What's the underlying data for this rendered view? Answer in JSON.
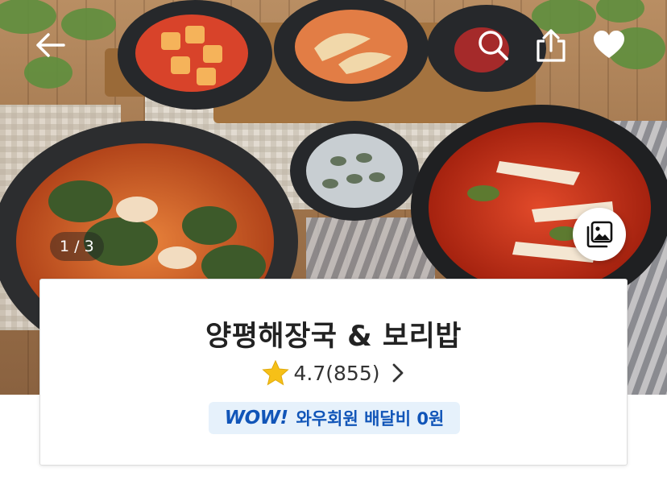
{
  "hero": {
    "image_alt": "food photo",
    "counter": "1 / 3"
  },
  "topbar": {
    "back_icon": "arrow-left-icon",
    "search_icon": "search-icon",
    "share_icon": "share-icon",
    "favorite_icon": "heart-icon"
  },
  "gallery": {
    "icon": "photo-gallery-icon"
  },
  "store": {
    "name": "양평해장국 & 보리밥",
    "rating": "4.7",
    "review_count": "(855)",
    "membership": {
      "logo": "WOW!",
      "text": "와우회원 배달비 0원"
    }
  },
  "colors": {
    "brand_blue": "#1155b8",
    "badge_bg": "#e6f1fb",
    "star": "#f6c017"
  }
}
